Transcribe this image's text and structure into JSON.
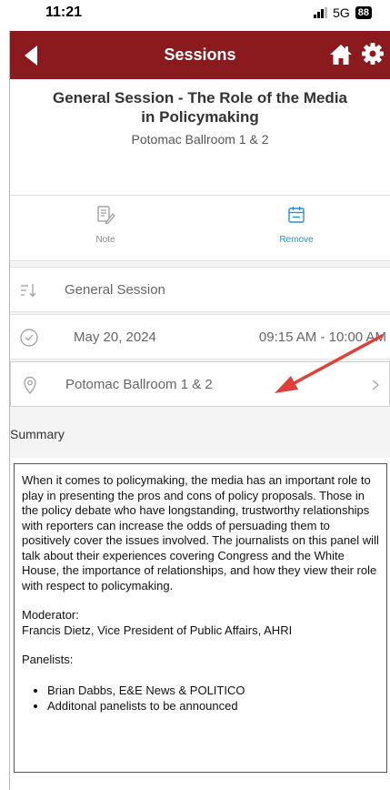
{
  "status_bar": {
    "time": "11:21",
    "network": "5G",
    "battery": "88"
  },
  "header": {
    "title": "Sessions"
  },
  "session": {
    "title": "General Session - The Role of the Media in Policymaking",
    "room": "Potomac Ballroom 1 & 2"
  },
  "actions": {
    "note_label": "Note",
    "remove_label": "Remove"
  },
  "details": {
    "type": "General Session",
    "date": "May 20, 2024",
    "time": "09:15 AM - 10:00 AM",
    "location": "Potomac Ballroom 1 & 2"
  },
  "summary": {
    "heading": "Summary",
    "paragraph": "When it comes to policymaking, the media has an important role to play in presenting the pros and cons of policy proposals. Those in the policy debate who have longstanding, trustworthy relationships with reporters can increase the odds of persuading them to positively cover the issues involved.  The journalists on this panel will talk about their experiences covering Congress and the White House, the importance of relationships, and how they view their role with respect to policymaking.",
    "moderator_label": "Moderator:",
    "moderator": "Francis Dietz, Vice President of Public Affairs, AHRI",
    "panelists_label": "Panelists:",
    "panelists": [
      "Brian Dabbs, E&E News & POLITICO",
      "Additonal panelists to be announced"
    ]
  },
  "colors": {
    "header": "#8a1a1e",
    "accent": "#2a8fd6",
    "annotation_arrow": "#e0403a"
  }
}
